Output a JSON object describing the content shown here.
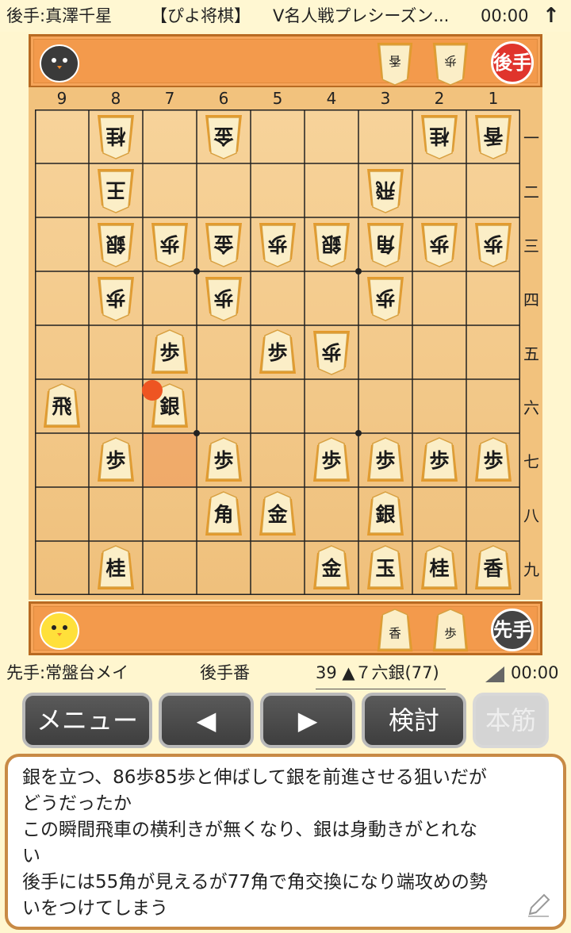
{
  "header": {
    "gote_player": "後手:真澤千星",
    "app_name": "【ぴよ将棋】",
    "event": "V名人戦プレシーズン...",
    "gote_clock": "00:00",
    "up_arrow": "↑"
  },
  "gote_tray": {
    "badge": "後手",
    "avatar_icon": "black-chick-icon",
    "pieces": [
      "香",
      "歩"
    ]
  },
  "sente_tray": {
    "badge": "先手",
    "avatar_icon": "yellow-chick-icon",
    "pieces": [
      "香",
      "歩"
    ]
  },
  "board": {
    "file_labels": [
      "9",
      "8",
      "7",
      "6",
      "5",
      "4",
      "3",
      "2",
      "1"
    ],
    "rank_labels": [
      "一",
      "二",
      "三",
      "四",
      "五",
      "六",
      "七",
      "八",
      "九"
    ],
    "pieces": [
      {
        "label": "桂",
        "side": "gote",
        "file": 8,
        "rank": 1
      },
      {
        "label": "金",
        "side": "gote",
        "file": 6,
        "rank": 1
      },
      {
        "label": "桂",
        "side": "gote",
        "file": 2,
        "rank": 1
      },
      {
        "label": "香",
        "side": "gote",
        "file": 1,
        "rank": 1
      },
      {
        "label": "王",
        "side": "gote",
        "file": 8,
        "rank": 2
      },
      {
        "label": "飛",
        "side": "gote",
        "file": 3,
        "rank": 2
      },
      {
        "label": "銀",
        "side": "gote",
        "file": 8,
        "rank": 3
      },
      {
        "label": "歩",
        "side": "gote",
        "file": 7,
        "rank": 3
      },
      {
        "label": "金",
        "side": "gote",
        "file": 6,
        "rank": 3
      },
      {
        "label": "歩",
        "side": "gote",
        "file": 5,
        "rank": 3
      },
      {
        "label": "銀",
        "side": "gote",
        "file": 4,
        "rank": 3
      },
      {
        "label": "角",
        "side": "gote",
        "file": 3,
        "rank": 3
      },
      {
        "label": "歩",
        "side": "gote",
        "file": 2,
        "rank": 3
      },
      {
        "label": "歩",
        "side": "gote",
        "file": 1,
        "rank": 3
      },
      {
        "label": "歩",
        "side": "gote",
        "file": 8,
        "rank": 4
      },
      {
        "label": "歩",
        "side": "gote",
        "file": 6,
        "rank": 4
      },
      {
        "label": "歩",
        "side": "gote",
        "file": 3,
        "rank": 4
      },
      {
        "label": "歩",
        "side": "sente",
        "file": 7,
        "rank": 5
      },
      {
        "label": "歩",
        "side": "sente",
        "file": 5,
        "rank": 5
      },
      {
        "label": "歩",
        "side": "gote",
        "file": 4,
        "rank": 5
      },
      {
        "label": "飛",
        "side": "sente",
        "file": 9,
        "rank": 6
      },
      {
        "label": "銀",
        "side": "sente",
        "file": 7,
        "rank": 6
      },
      {
        "label": "歩",
        "side": "sente",
        "file": 8,
        "rank": 7
      },
      {
        "label": "歩",
        "side": "sente",
        "file": 6,
        "rank": 7
      },
      {
        "label": "歩",
        "side": "sente",
        "file": 4,
        "rank": 7
      },
      {
        "label": "歩",
        "side": "sente",
        "file": 3,
        "rank": 7
      },
      {
        "label": "歩",
        "side": "sente",
        "file": 2,
        "rank": 7
      },
      {
        "label": "歩",
        "side": "sente",
        "file": 1,
        "rank": 7
      },
      {
        "label": "角",
        "side": "sente",
        "file": 6,
        "rank": 8
      },
      {
        "label": "金",
        "side": "sente",
        "file": 5,
        "rank": 8
      },
      {
        "label": "銀",
        "side": "sente",
        "file": 3,
        "rank": 8
      },
      {
        "label": "桂",
        "side": "sente",
        "file": 8,
        "rank": 9
      },
      {
        "label": "金",
        "side": "sente",
        "file": 4,
        "rank": 9
      },
      {
        "label": "玉",
        "side": "sente",
        "file": 3,
        "rank": 9
      },
      {
        "label": "桂",
        "side": "sente",
        "file": 2,
        "rank": 9
      },
      {
        "label": "香",
        "side": "sente",
        "file": 1,
        "rank": 9
      }
    ],
    "last_move_from": {
      "file": 7,
      "rank": 7
    },
    "last_move_to": {
      "file": 7,
      "rank": 6
    }
  },
  "colors": {
    "tray_bg": "#f39a4c",
    "gote_badge": "#e0342c",
    "sente_badge": "#444444",
    "highlight": "#f0a060",
    "marker": "#ee5522"
  },
  "info": {
    "sente_player": "先手:常盤台メイ",
    "turn": "後手番",
    "move": "39 ▲７六銀(77)",
    "sente_clock": "00:00"
  },
  "buttons": {
    "menu": "メニュー",
    "prev": "◀",
    "next": "▶",
    "analyze": "検討",
    "mainline": "本筋"
  },
  "comment": {
    "text": "銀を立つ、86歩85歩と伸ばして銀を前進させる狙いだが\nどうだったか\nこの瞬間飛車の横利きが無くなり、銀は身動きがとれな\nい\n後手には55角が見えるが77角で角交換になり端攻めの勢\nいをつけてしまう",
    "edit_icon": "pencil-icon"
  }
}
